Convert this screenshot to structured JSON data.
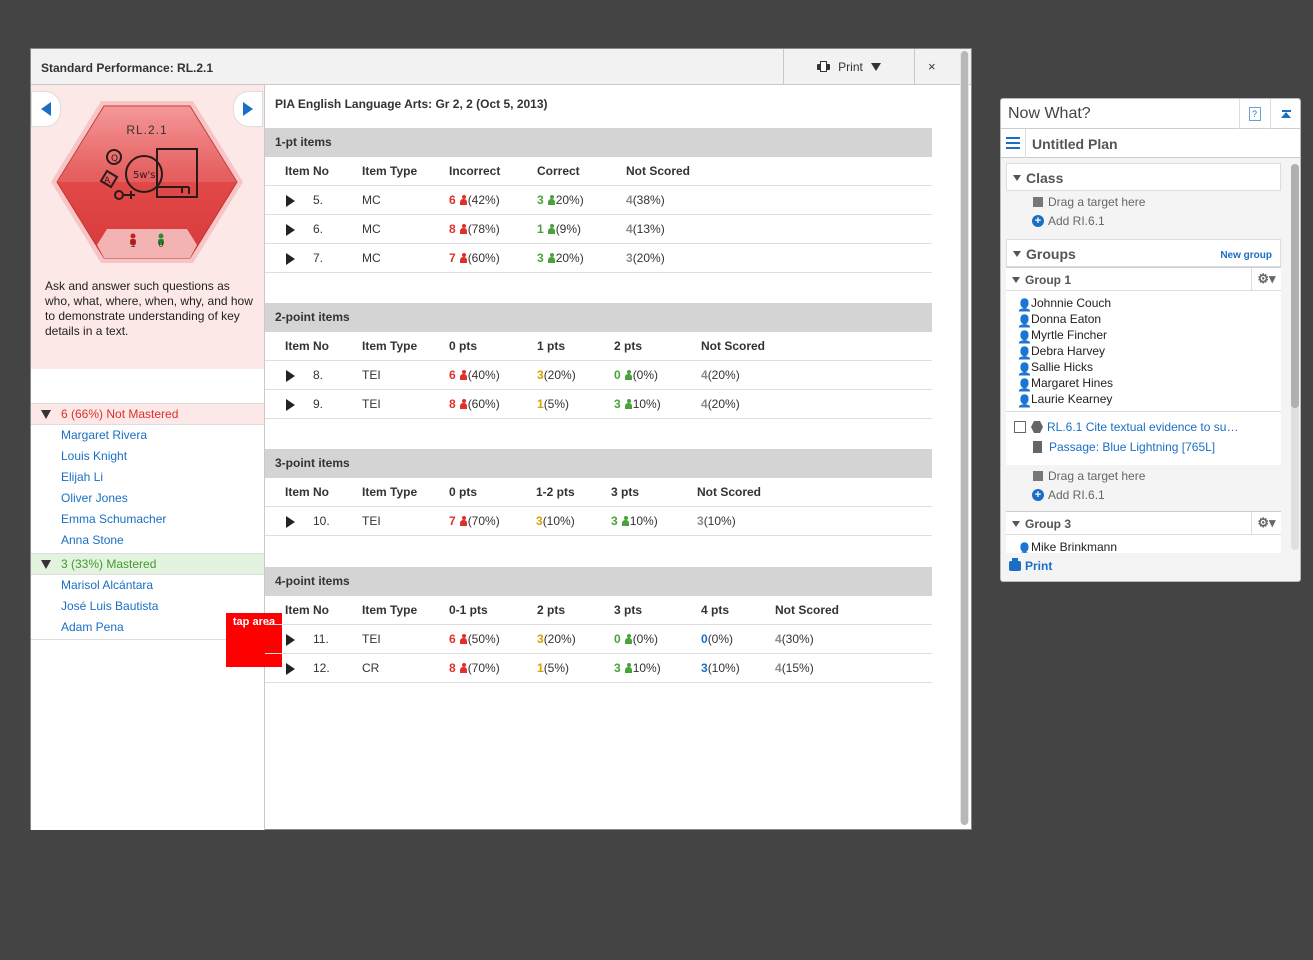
{
  "window": {
    "title": "Standard Performance: RL.2.1",
    "print_label": "Print",
    "close_label": "×"
  },
  "standard": {
    "code": "RL.2.1",
    "not_mastered_count": "1",
    "mastered_count": "0",
    "description": "Ask and answer such questions as who, what, where, when, why, and how to demonstrate understanding of key details in a text."
  },
  "groups": {
    "not_mastered": {
      "label": "6 (66%) Not Mastered",
      "students": [
        "Margaret Rivera",
        "Louis Knight",
        "Elijah Li",
        "Oliver Jones",
        "Emma Schumacher",
        "Anna Stone"
      ]
    },
    "mastered": {
      "label": "3 (33%) Mastered",
      "students": [
        "Marisol Alcántara",
        "José Luis Bautista",
        "Adam Pena"
      ]
    }
  },
  "tap_area_label": "tap area",
  "assessment_title": "PIA English Language Arts: Gr 2, 2 (Oct 5, 2013)",
  "sections": {
    "s1": {
      "title": "1-pt items",
      "headers": [
        "Item No",
        "Item Type",
        "Incorrect",
        "Correct",
        "Not Scored"
      ],
      "rows": [
        {
          "no": "5.",
          "type": "MC",
          "c1n": "6",
          "c1p": "(42%)",
          "c2n": "3",
          "c2p": "20%)",
          "ns": "4",
          "nsp": "(38%)"
        },
        {
          "no": "6.",
          "type": "MC",
          "c1n": "8",
          "c1p": "(78%)",
          "c2n": "1",
          "c2p": "(9%)",
          "ns": "4",
          "nsp": "(13%)"
        },
        {
          "no": "7.",
          "type": "MC",
          "c1n": "7",
          "c1p": "(60%)",
          "c2n": "3",
          "c2p": "20%)",
          "ns": "3",
          "nsp": "(20%)"
        }
      ]
    },
    "s2": {
      "title": "2-point items",
      "headers": [
        "Item No",
        "Item Type",
        "0 pts",
        "1 pts",
        "2 pts",
        "Not Scored"
      ],
      "rows": [
        {
          "no": "8.",
          "type": "TEI",
          "c1n": "6",
          "c1p": "(40%)",
          "c2n": "3",
          "c2p": "(20%)",
          "c3n": "0",
          "c3p": "(0%)",
          "ns": "4",
          "nsp": "(20%)"
        },
        {
          "no": "9.",
          "type": "TEI",
          "c1n": "8",
          "c1p": "(60%)",
          "c2n": "1",
          "c2p": "(5%)",
          "c3n": "3",
          "c3p": "10%)",
          "ns": "4",
          "nsp": "(20%)"
        }
      ]
    },
    "s3": {
      "title": "3-point items",
      "headers": [
        "Item No",
        "Item Type",
        "0 pts",
        "1-2 pts",
        "3 pts",
        "Not Scored"
      ],
      "rows": [
        {
          "no": "10.",
          "type": "TEI",
          "c1n": "7",
          "c1p": "(70%)",
          "c2n": "3",
          "c2p": "(10%)",
          "c3n": "3",
          "c3p": "10%)",
          "ns": "3",
          "nsp": "(10%)"
        }
      ]
    },
    "s4": {
      "title": "4-point items",
      "headers": [
        "Item No",
        "Item Type",
        "0-1 pts",
        "2 pts",
        "3 pts",
        "4 pts",
        "Not Scored"
      ],
      "rows": [
        {
          "no": "11.",
          "type": "TEI",
          "c1n": "6",
          "c1p": "(50%)",
          "c2n": "3",
          "c2p": "(20%)",
          "c3n": "0",
          "c3p": "(0%)",
          "c4n": "0",
          "c4p": "(0%)",
          "ns": "4",
          "nsp": "(30%)"
        },
        {
          "no": "12.",
          "type": "CR",
          "c1n": "8",
          "c1p": "(70%)",
          "c2n": "1",
          "c2p": "(5%)",
          "c3n": "3",
          "c3p": "10%)",
          "c4n": "3",
          "c4p": "(10%)",
          "ns": "4",
          "nsp": "(15%)"
        }
      ]
    }
  },
  "now_what": {
    "title": "Now What?",
    "help_label": "?",
    "plan_name": "Untitled Plan",
    "class_label": "Class",
    "drag_label": "Drag a target here",
    "add_label": "Add RI.6.1",
    "groups_label": "Groups",
    "new_group_label": "New group",
    "group1": {
      "label": "Group 1",
      "members": [
        "Johnnie Couch",
        "Donna Eaton",
        "Myrtle Fincher",
        "Debra Harvey",
        "Sallie Hicks",
        "Margaret Hines",
        "Laurie Kearney"
      ],
      "target_label": "RL.6.1 Cite textual evidence to su…",
      "passage_label": "Passage: Blue Lightning [765L]"
    },
    "group3": {
      "label": "Group 3",
      "members": [
        "Mike Brinkmann"
      ]
    },
    "print_label": "Print"
  },
  "colors": {
    "incorrect": "#e0302c",
    "correct": "#4aa33a",
    "partial": "#d9a000",
    "not_scored": "#8a8a8a",
    "link": "#1a6fc4",
    "hexagon": "#e05050"
  }
}
